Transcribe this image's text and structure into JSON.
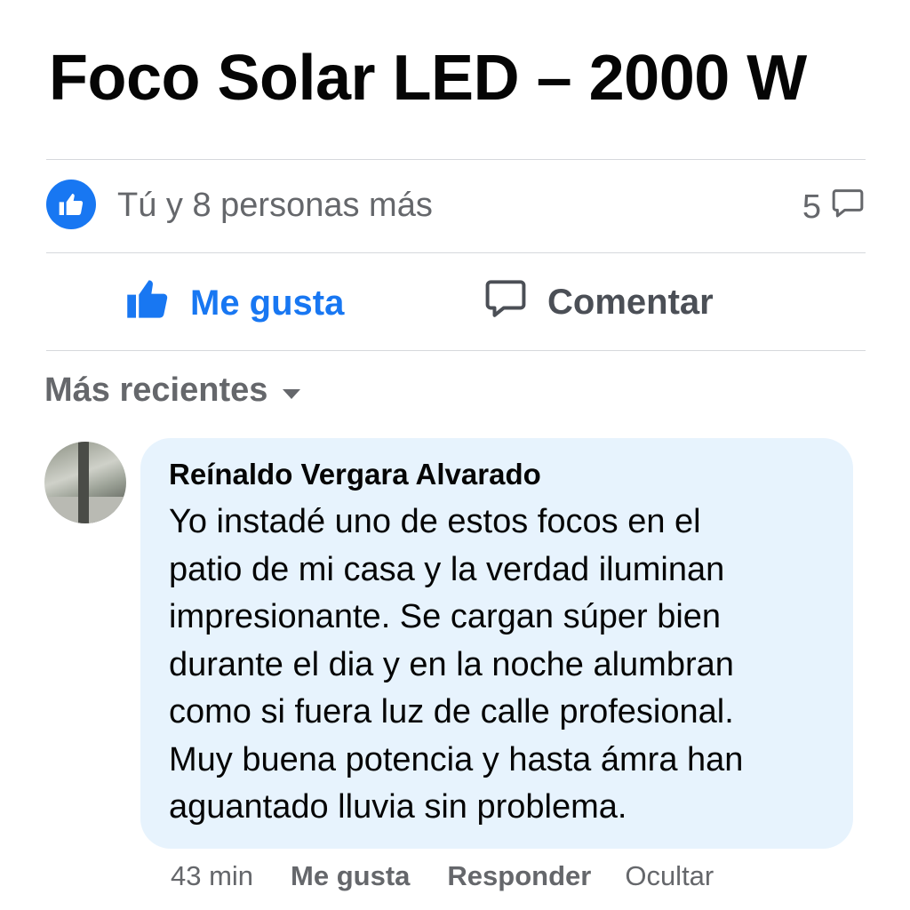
{
  "post": {
    "title": "Foco Solar LED – 2000 W"
  },
  "reactions": {
    "like_icon": "thumbs-up-icon",
    "summary": "Tú y 8 personas más",
    "comment_count": "5",
    "comment_icon": "speech-bubble-icon"
  },
  "actions": {
    "like_label": "Me gusta",
    "comment_label": "Comentar"
  },
  "sort": {
    "label": "Más recientes"
  },
  "comment": {
    "author": "Reínaldo Vergara Alvarado",
    "lines": [
      "Yo instadé uno de estos focos en el",
      "patio de mi casa y la verdad iluminan",
      "impresionante. Se cargan súper bien",
      "durante el dia y en la noche alumbran",
      "como si fuera luz de calle profesional.",
      "Muy buena potencia y hasta ámra han",
      "aguantado lluvia sin problema."
    ],
    "time": "43 min",
    "like_label": "Me gusta",
    "reply_label": "Responder",
    "hide_label": "Ocultar"
  },
  "colors": {
    "accent": "#1877f2",
    "secondary_text": "#65676b",
    "bubble": "#e7f3fd"
  }
}
